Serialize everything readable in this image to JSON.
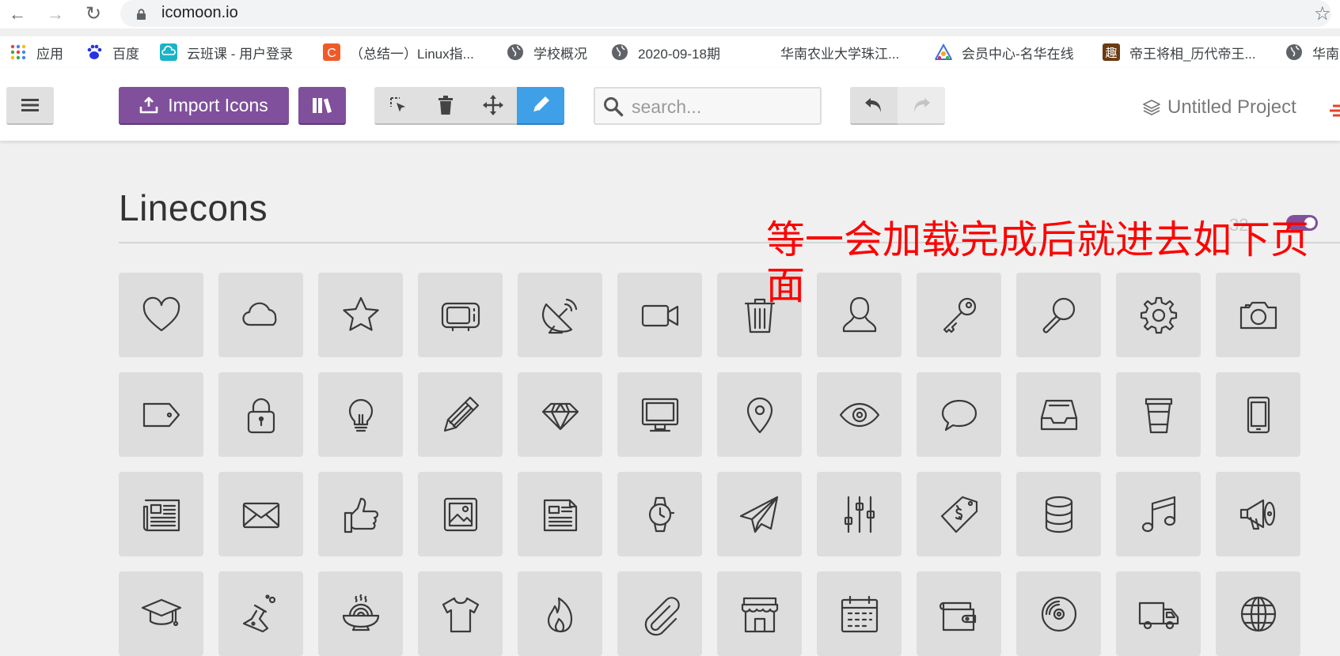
{
  "browser": {
    "url": "icomoon.io",
    "bookmarks": [
      {
        "label": "应用",
        "icon": "apps-grid-icon"
      },
      {
        "label": "百度",
        "icon": "baidu-paw-icon"
      },
      {
        "label": "云班课 - 用户登录",
        "icon": "cloud-class-icon"
      },
      {
        "label": "（总结一）Linux指...",
        "icon": "csdn-c-icon"
      },
      {
        "label": "学校概况",
        "icon": "globe-icon"
      },
      {
        "label": "2020-09-18期",
        "icon": "globe-icon"
      },
      {
        "label": "华南农业大学珠江...",
        "icon": "blank-icon"
      },
      {
        "label": "会员中心-名华在线",
        "icon": "triangle-logo-icon"
      },
      {
        "label": "帝王将相_历代帝王...",
        "icon": "qu-character-icon"
      },
      {
        "label": "华南",
        "icon": "globe-icon"
      }
    ]
  },
  "header": {
    "import_label": "Import Icons",
    "search_placeholder": "search...",
    "project_name": "Untitled Project"
  },
  "section": {
    "title": "Linecons",
    "count": "32",
    "note": "等一会加载完成后就进去如下页面"
  },
  "icons": [
    "heart-icon",
    "cloud-icon",
    "star-icon",
    "tv-icon",
    "satellite-dish-icon",
    "video-camera-icon",
    "trash-icon",
    "user-icon",
    "key-icon",
    "search-icon",
    "gear-icon",
    "camera-icon",
    "tag-icon",
    "lock-icon",
    "lightbulb-icon",
    "pencil-icon",
    "diamond-icon",
    "monitor-icon",
    "location-pin-icon",
    "eye-icon",
    "speech-bubble-icon",
    "inbox-tray-icon",
    "cup-icon",
    "tablet-icon",
    "newspaper-icon",
    "envelope-icon",
    "thumbs-up-icon",
    "image-icon",
    "news-document-icon",
    "watch-icon",
    "paper-plane-icon",
    "sliders-icon",
    "money-tag-icon",
    "database-icon",
    "music-note-icon",
    "megaphone-icon",
    "graduation-cap-icon",
    "flask-icon",
    "noodle-bowl-icon",
    "t-shirt-icon",
    "fire-icon",
    "paperclip-icon",
    "shop-icon",
    "calendar-icon",
    "wallet-icon",
    "disc-icon",
    "truck-icon",
    "globe-icon"
  ],
  "colors": {
    "accent_purple": "#80509c",
    "active_blue": "#3fa0e8",
    "annotation_red": "#ff0000"
  }
}
